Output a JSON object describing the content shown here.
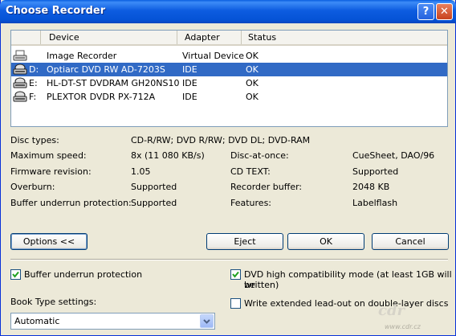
{
  "window": {
    "title": "Choose Recorder"
  },
  "titlebar_buttons": {
    "help": "?",
    "close": "✕"
  },
  "list": {
    "columns": [
      "Device",
      "Adapter",
      "Status"
    ],
    "rows": [
      {
        "drive": "",
        "device": "Image Recorder",
        "adapter": "Virtual Device",
        "status": "OK",
        "selected": false
      },
      {
        "drive": "D:",
        "device": "Optiarc DVD RW AD-7203S",
        "adapter": "IDE",
        "status": "OK",
        "selected": true
      },
      {
        "drive": "E:",
        "device": "HL-DT-ST DVDRAM GH20NS10",
        "adapter": "IDE",
        "status": "OK",
        "selected": false
      },
      {
        "drive": "F:",
        "device": "PLEXTOR DVDR   PX-712A",
        "adapter": "IDE",
        "status": "OK",
        "selected": false
      }
    ]
  },
  "info": {
    "disc_types_label": "Disc types:",
    "disc_types_value": "CD-R/RW; DVD R/RW; DVD DL; DVD-RAM",
    "max_speed_label": "Maximum speed:",
    "max_speed_value": "8x (11 080 KB/s)",
    "disc_at_once_label": "Disc-at-once:",
    "disc_at_once_value": "CueSheet, DAO/96",
    "firmware_label": "Firmware revision:",
    "firmware_value": "1.05",
    "cd_text_label": "CD TEXT:",
    "cd_text_value": "Supported",
    "overburn_label": "Overburn:",
    "overburn_value": "Supported",
    "recorder_buffer_label": "Recorder buffer:",
    "recorder_buffer_value": "2048 KB",
    "buffer_underrun_label": "Buffer underrun protection:",
    "buffer_underrun_value": "Supported",
    "features_label": "Features:",
    "features_value": "Labelflash"
  },
  "buttons": {
    "options": "Options <<",
    "eject": "Eject",
    "ok": "OK",
    "cancel": "Cancel"
  },
  "options": {
    "buffer_underrun": {
      "label": "Buffer underrun protection",
      "checked": true
    },
    "dvd_high_compat": {
      "label_line1": "DVD high compatibility mode (at least 1GB will be",
      "label_line2": "written)",
      "checked": true
    },
    "extended_leadout": {
      "label": "Write extended lead-out on double-layer discs",
      "checked": false
    },
    "book_type_label": "Book Type settings:",
    "book_type_value": "Automatic"
  },
  "watermark": {
    "logo": "cdr",
    "url": "www.cdr.cz"
  },
  "colors": {
    "selection": "#316ac5",
    "titlebar": "#0553d6",
    "dialog_bg": "#ece9d8"
  }
}
